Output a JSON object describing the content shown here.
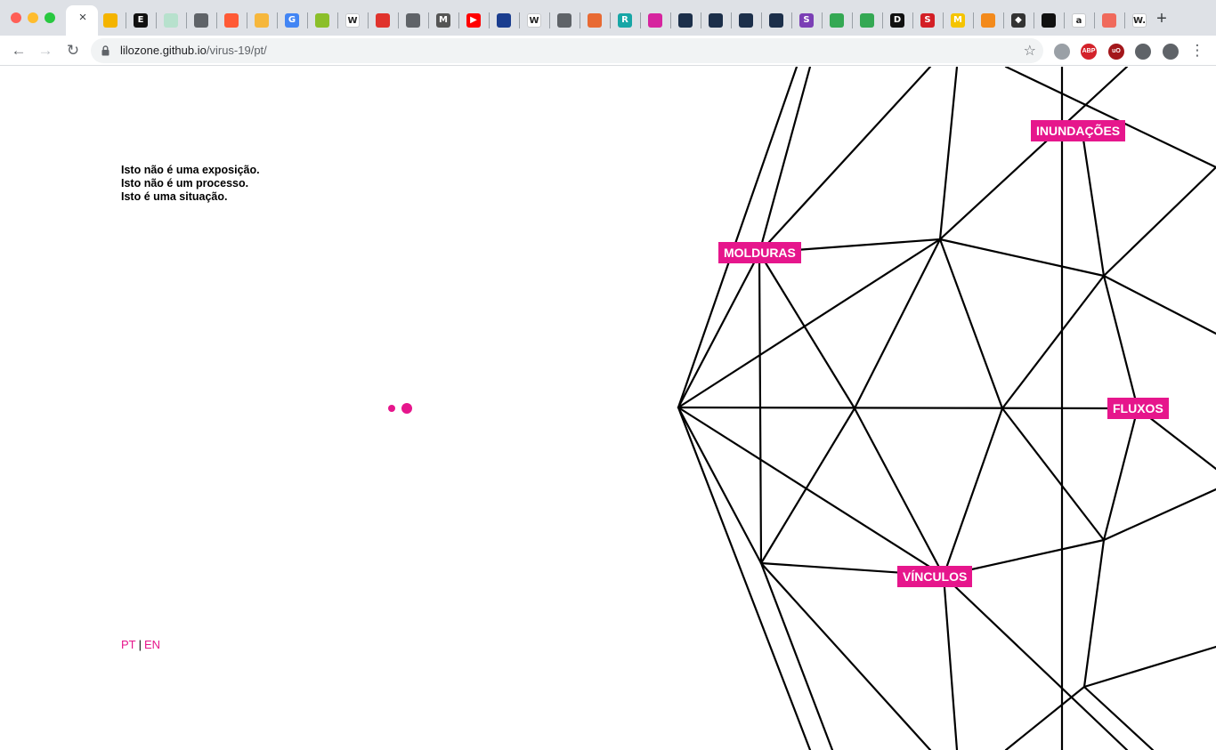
{
  "browser": {
    "url_host": "lilozone.github.io",
    "url_path": "/virus-19/pt/",
    "active_tab_close": "×",
    "new_tab": "+",
    "back": "←",
    "forward": "→",
    "reload": "↻",
    "bookmark": "☆",
    "menu": "⋮",
    "favicons": [
      {
        "icon": "slides-icon",
        "color": "#f4b400",
        "glyph": ""
      },
      {
        "icon": "etsy-e-icon",
        "color": "#111111",
        "glyph": "E"
      },
      {
        "icon": "sheets-outline-icon",
        "color": "#b7e1cd",
        "glyph": ""
      },
      {
        "icon": "globe-icon",
        "color": "#5f6368",
        "glyph": ""
      },
      {
        "icon": "flame-icon",
        "color": "#ff5a36",
        "glyph": ""
      },
      {
        "icon": "infinity-icon",
        "color": "#f6b73c",
        "glyph": ""
      },
      {
        "icon": "google-icon",
        "color": "#4285f4",
        "glyph": "G"
      },
      {
        "icon": "green-box-icon",
        "color": "#8bbf2a",
        "glyph": ""
      },
      {
        "icon": "wikipedia-icon",
        "color": "#ffffff",
        "glyph": "W"
      },
      {
        "icon": "red-bookmark-icon",
        "color": "#e0332d",
        "glyph": ""
      },
      {
        "icon": "globe-icon",
        "color": "#5f6368",
        "glyph": ""
      },
      {
        "icon": "medium-m-icon",
        "color": "#555555",
        "glyph": "M"
      },
      {
        "icon": "youtube-icon",
        "color": "#ff0000",
        "glyph": "▶"
      },
      {
        "icon": "blue-circle-icon",
        "color": "#1a3d8f",
        "glyph": ""
      },
      {
        "icon": "wikipedia-icon",
        "color": "#ffffff",
        "glyph": "W"
      },
      {
        "icon": "globe-icon",
        "color": "#5f6368",
        "glyph": ""
      },
      {
        "icon": "book-icon",
        "color": "#e86a33",
        "glyph": ""
      },
      {
        "icon": "r-square-icon",
        "color": "#17a6a6",
        "glyph": "R"
      },
      {
        "icon": "instagram-icon",
        "color": "#d6249f",
        "glyph": ""
      },
      {
        "icon": "sprite-icon",
        "color": "#1c2f4a",
        "glyph": ""
      },
      {
        "icon": "sprite-icon",
        "color": "#1c2f4a",
        "glyph": ""
      },
      {
        "icon": "sprite-icon",
        "color": "#1c2f4a",
        "glyph": ""
      },
      {
        "icon": "sprite-icon",
        "color": "#1c2f4a",
        "glyph": ""
      },
      {
        "icon": "purple-s-icon",
        "color": "#7b3fb5",
        "glyph": "S"
      },
      {
        "icon": "drive-icon",
        "color": "#34a853",
        "glyph": ""
      },
      {
        "icon": "drive-icon",
        "color": "#34a853",
        "glyph": ""
      },
      {
        "icon": "d-icon",
        "color": "#111111",
        "glyph": "D"
      },
      {
        "icon": "red-s-icon",
        "color": "#d31f26",
        "glyph": "S"
      },
      {
        "icon": "yellow-m-icon",
        "color": "#f5c400",
        "glyph": "M"
      },
      {
        "icon": "orange-grid-icon",
        "color": "#f38a1c",
        "glyph": ""
      },
      {
        "icon": "diamond-icon",
        "color": "#333333",
        "glyph": "◆"
      },
      {
        "icon": "black-circle-icon",
        "color": "#111111",
        "glyph": ""
      },
      {
        "icon": "amazon-icon",
        "color": "#ffffff",
        "glyph": "a"
      },
      {
        "icon": "target-icon",
        "color": "#f06a5c",
        "glyph": ""
      },
      {
        "icon": "w-dot-icon",
        "color": "#ffffff",
        "glyph": "W."
      }
    ],
    "extensions": [
      {
        "icon": "database-icon",
        "color": "#9aa0a6",
        "glyph": ""
      },
      {
        "icon": "adblock-plus-icon",
        "color": "#d3222a",
        "glyph": "ABP"
      },
      {
        "icon": "ublock-icon",
        "color": "#a3171b",
        "glyph": "uO"
      },
      {
        "icon": "puzzle-icon",
        "color": "#5f6368",
        "glyph": ""
      },
      {
        "icon": "profile-icon",
        "color": "#5f6368",
        "glyph": ""
      }
    ]
  },
  "page": {
    "accent": "#e6168c",
    "intro": [
      "Isto não é uma exposição.",
      "Isto não é um processo.",
      "Isto é uma situação."
    ],
    "lang": {
      "pt": "PT",
      "separator": "|",
      "en": "EN"
    },
    "labels": {
      "inundacoes": "INUNDAÇÕES",
      "molduras": "MOLDURAS",
      "fluxos": "FLUXOS",
      "vinculos": "VÍNCULOS"
    }
  }
}
